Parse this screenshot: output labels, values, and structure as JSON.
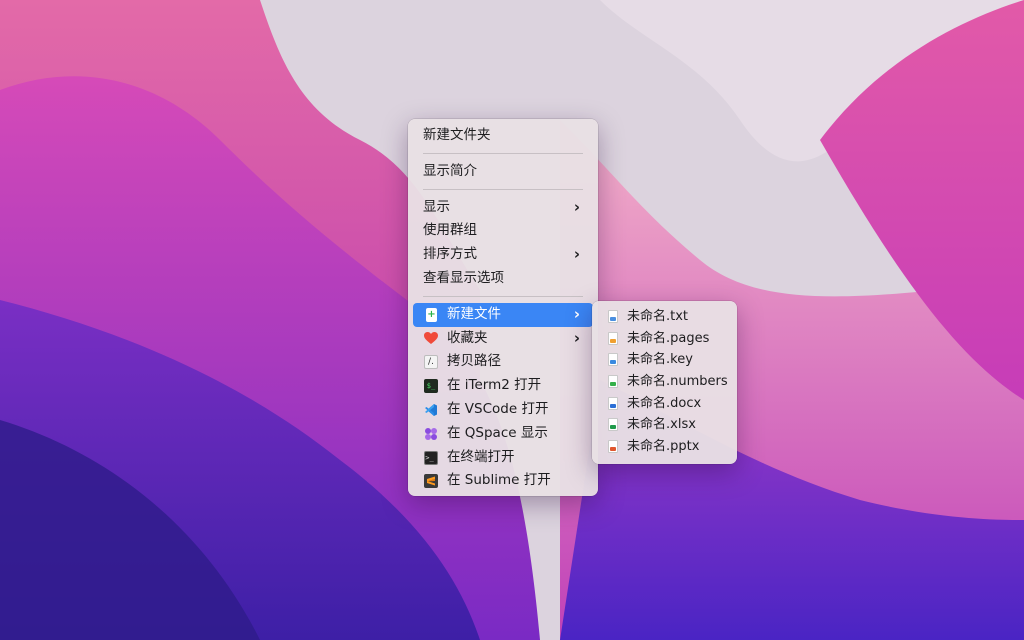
{
  "colors": {
    "menu_highlight": "#3a86f5",
    "menu_background": "#e8e0e4"
  },
  "main_menu": {
    "new_folder": "新建文件夹",
    "get_info": "显示简介",
    "show": "显示",
    "use_groups": "使用群组",
    "sort_by": "排序方式",
    "show_view_options": "查看显示选项",
    "new_file": "新建文件",
    "favorites": "收藏夹",
    "copy_path": "拷贝路径",
    "open_in_iterm2": "在 iTerm2 打开",
    "open_in_vscode": "在 VSCode 打开",
    "show_in_qspace": "在 QSpace 显示",
    "open_in_terminal": "在终端打开",
    "open_in_sublime": "在 Sublime 打开",
    "chevron": "›"
  },
  "sub_menu": {
    "items": [
      {
        "label": "未命名.txt",
        "icon": "txt-file-icon",
        "color": "#4a8fe0"
      },
      {
        "label": "未命名.pages",
        "icon": "pages-file-icon",
        "color": "#f0a030"
      },
      {
        "label": "未命名.key",
        "icon": "key-file-icon",
        "color": "#3a8ae0"
      },
      {
        "label": "未命名.numbers",
        "icon": "numbers-file-icon",
        "color": "#35b04a"
      },
      {
        "label": "未命名.docx",
        "icon": "docx-file-icon",
        "color": "#2b6fd6"
      },
      {
        "label": "未命名.xlsx",
        "icon": "xlsx-file-icon",
        "color": "#1f9a4a"
      },
      {
        "label": "未命名.pptx",
        "icon": "pptx-file-icon",
        "color": "#e0572e"
      }
    ]
  }
}
